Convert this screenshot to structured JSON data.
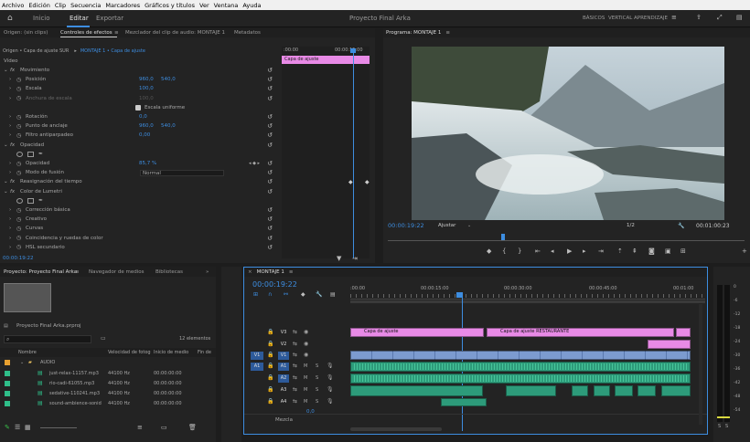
{
  "menu": [
    "Archivo",
    "Edición",
    "Clip",
    "Secuencia",
    "Marcadores",
    "Gráficos y títulos",
    "Ver",
    "Ventana",
    "Ayuda"
  ],
  "topbar": {
    "tabs": [
      "Inicio",
      "Importar",
      "Editar",
      "Exportar"
    ],
    "active": "Editar",
    "project_title": "Proyecto Final Arka",
    "workspaces": [
      "BÁSICOS",
      "VERTICAL",
      "APRENDIZAJE"
    ]
  },
  "effects_tabs": [
    "Origen: (sin clips)",
    "Controles de efectos",
    "Mezclador del clip de audio: MONTAJE 1",
    "Metadatos"
  ],
  "effects_source": {
    "source": "Origen • Capa de ajuste SUR",
    "sequence": "MONTAJE 1 • Capa de ajuste"
  },
  "effects_timeline": {
    "t0": ":00:00",
    "t1": "00:00:15:00",
    "clip": "Capa de ajuste"
  },
  "effects": {
    "video_label": "Vídeo",
    "rows": [
      {
        "label": "Movimiento",
        "indent": 1,
        "fx": true
      },
      {
        "label": "Posición",
        "indent": 2,
        "v1": "960,0",
        "v2": "540,0"
      },
      {
        "label": "Escala",
        "indent": 2,
        "v1": "100,0"
      },
      {
        "label": "Anchura de escala",
        "indent": 2,
        "v1": "100,0",
        "dim": true
      },
      {
        "label": "Escala uniforme",
        "indent": 0,
        "checkbox": true
      },
      {
        "label": "Rotación",
        "indent": 2,
        "v1": "0,0"
      },
      {
        "label": "Punto de anclaje",
        "indent": 2,
        "v1": "960,0",
        "v2": "540,0"
      },
      {
        "label": "Filtro antiparpadeo",
        "indent": 2,
        "v1": "0,00"
      },
      {
        "label": "Opacidad",
        "indent": 1,
        "fx": true
      },
      {
        "label": "",
        "indent": 1,
        "shapes": true
      },
      {
        "label": "Opacidad",
        "indent": 2,
        "v1": "85,7 %",
        "keyframes": true
      },
      {
        "label": "Modo de fusión",
        "indent": 2,
        "dropdown": "Normal"
      },
      {
        "label": "Reasignación del tiempo",
        "indent": 1,
        "fx": true
      },
      {
        "label": "Color de Lumetri",
        "indent": 1,
        "fx": true
      },
      {
        "label": "",
        "indent": 1,
        "shapes": true
      },
      {
        "label": "Corrección básica",
        "indent": 2
      },
      {
        "label": "Creativo",
        "indent": 2
      },
      {
        "label": "Curvas",
        "indent": 2
      },
      {
        "label": "Coincidencia y ruedas de color",
        "indent": 2
      },
      {
        "label": "HSL secundario",
        "indent": 2
      }
    ],
    "timecode": "00:00:19:22"
  },
  "program": {
    "title": "Programa: MONTAJE 1",
    "timecode": "00:00:19:22",
    "fit": "Ajustar",
    "ratio": "1/2",
    "duration": "00:01:00:23"
  },
  "project": {
    "tabs": [
      "Proyecto: Proyecto Final Arka",
      "Navegador de medios",
      "Bibliotecas"
    ],
    "file": "Proyecto Final Arka.prproj",
    "count": "12 elementos",
    "columns": [
      "Nombre",
      "Velocidad de fotog",
      "Inicio de medio",
      "Fin de"
    ],
    "folder": "AUDIO",
    "items": [
      {
        "name": "just-relax-11157.mp3",
        "rate": "44100 Hz",
        "start": "00:00:00:00"
      },
      {
        "name": "rio-cadi-61055.mp3",
        "rate": "44100 Hz",
        "start": "00:00:00:00"
      },
      {
        "name": "sedative-110241.mp3",
        "rate": "44100 Hz",
        "start": "00:00:00:00"
      },
      {
        "name": "sound-ambience-sonid",
        "rate": "44100 Hz",
        "start": "00:00:00:00"
      }
    ]
  },
  "timeline": {
    "tab": "MONTAJE 1",
    "timecode": "00:00:19:22",
    "ruler": [
      ":00:00",
      "00:00:15:00",
      "00:00:30:00",
      "00:00:45:00",
      "00:01:00"
    ],
    "tracks": [
      "V3",
      "V2",
      "V1",
      "A1",
      "A2",
      "A3",
      "A4"
    ],
    "master": "Mezcla",
    "master_val": "0,0",
    "clips": {
      "adj1": "Capa de ajuste",
      "adj2": "Capa de ajuste RESTAURANTE"
    }
  },
  "meter": {
    "labels": [
      "0",
      "-6",
      "-12",
      "-18",
      "-24",
      "-30",
      "-36",
      "-42",
      "-48",
      "-54"
    ],
    "solo": "S"
  }
}
